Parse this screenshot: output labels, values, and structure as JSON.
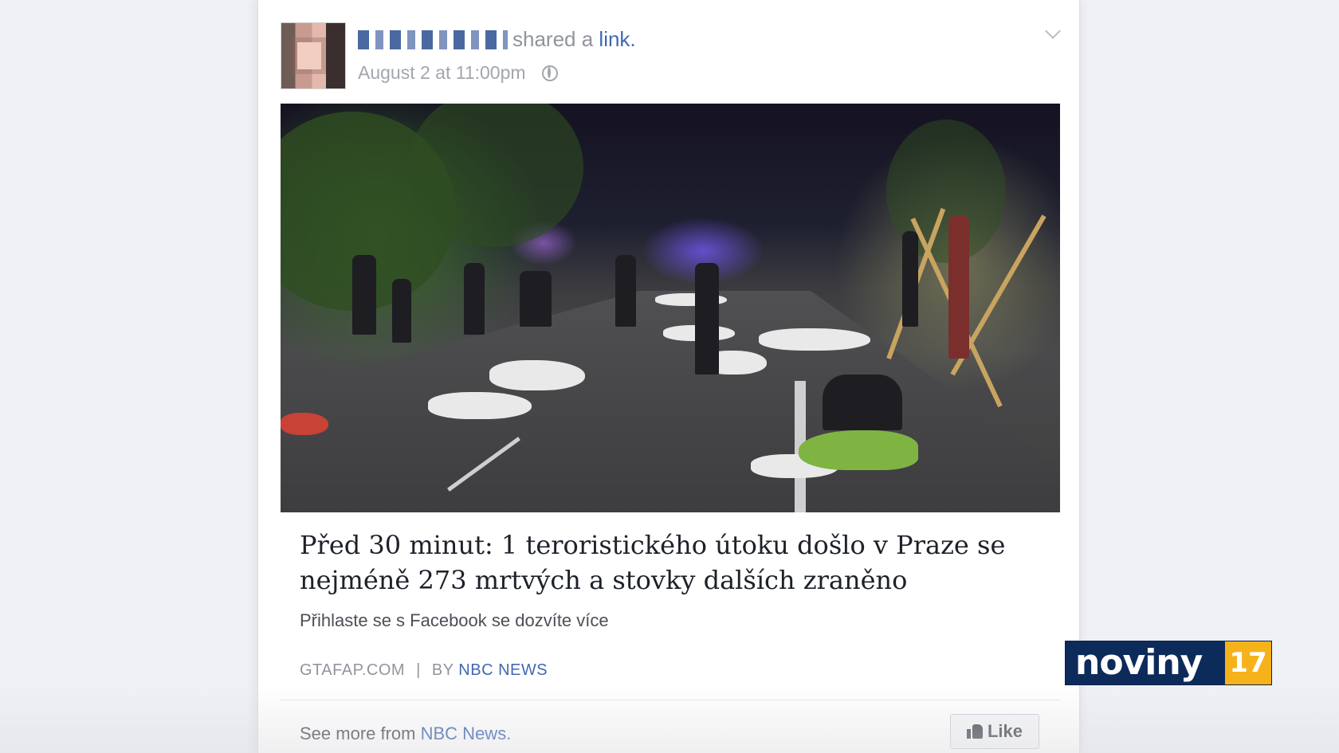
{
  "post": {
    "shared_text": "shared a",
    "link_word": "link.",
    "timestamp": "August 2 at 11:00pm"
  },
  "article": {
    "headline": "Před 30 minut: 1 teroristického útoku došlo v Praze se nejméně 273 mrtvých a stovky dalších zraněno",
    "subtitle": "Přihlaste se s Facebook se dozvíte více",
    "domain": "GTAFAP.COM",
    "separator": "|",
    "by": "BY",
    "source": "NBC NEWS"
  },
  "footer": {
    "see_more_prefix": "See more from",
    "see_more_source": "NBC News.",
    "like_label": "Like"
  },
  "overlay": {
    "channel_name": "noviny",
    "channel_number": "17"
  },
  "colors": {
    "link_blue": "#4267b2",
    "channel_navy": "#0d2b5a",
    "channel_accent": "#f6b21a"
  },
  "icons": [
    "globe-icon",
    "chevron-down-icon",
    "thumbs-up-icon"
  ]
}
